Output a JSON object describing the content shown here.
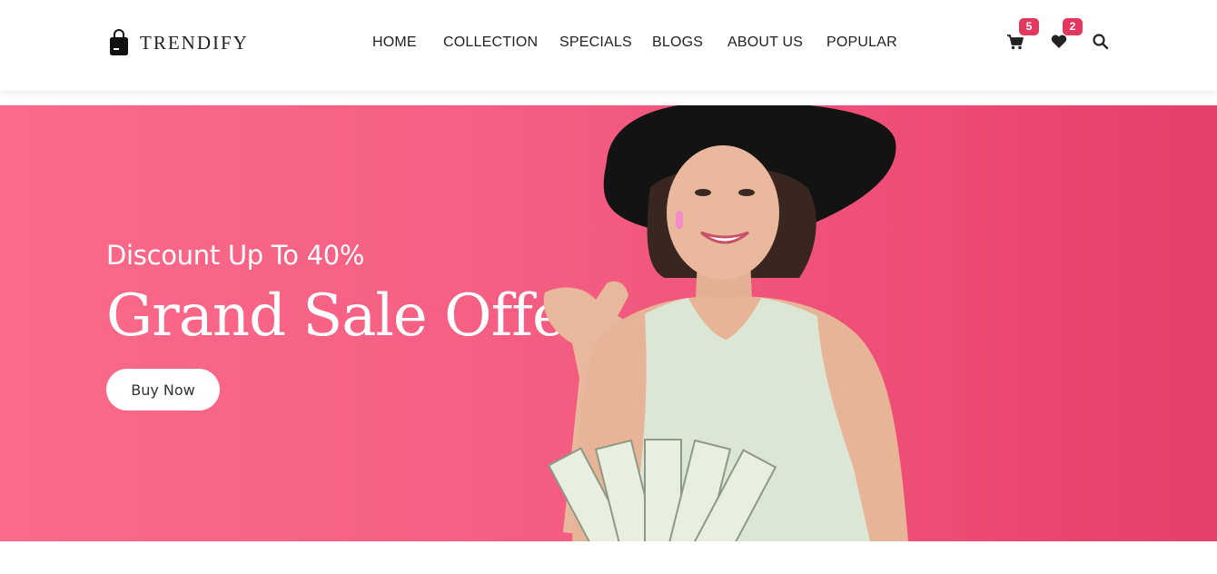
{
  "brand": {
    "name": "TRENDIFY"
  },
  "nav": {
    "items": [
      "HOME",
      "COLLECTION",
      "SPECIALS",
      "BLOGS",
      "ABOUT US",
      "POPULAR"
    ]
  },
  "header_icons": {
    "cart": {
      "icon": "cart-icon",
      "count": "5"
    },
    "wishlist": {
      "icon": "heart-icon",
      "count": "2"
    },
    "search": {
      "icon": "search-icon"
    }
  },
  "hero": {
    "subtitle": "Discount Up To 40%",
    "title": "Grand Sale Offer!",
    "button_label": "Buy Now",
    "image": "smiling-woman-with-money-photo"
  },
  "colors": {
    "accent": "#e2395e",
    "hero_background": "#f55f83"
  }
}
